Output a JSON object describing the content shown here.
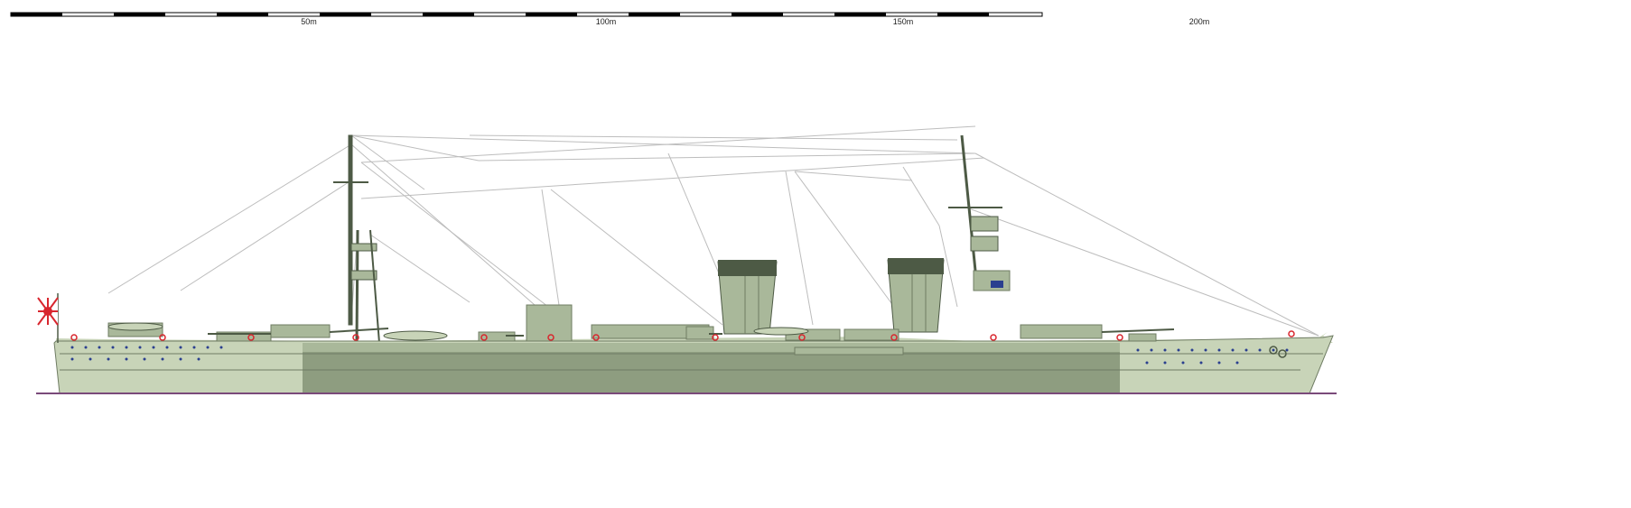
{
  "scale": {
    "unit_marks": [
      {
        "label": "50m"
      },
      {
        "label": "100m"
      },
      {
        "label": "150m"
      },
      {
        "label": "200m"
      }
    ]
  },
  "colors": {
    "hull_light": "#c8d4b8",
    "hull_mid": "#a9b89a",
    "hull_dark": "#8e9d80",
    "deck_line": "#6f7c63",
    "funnel_top": "#4d5a45",
    "rigging": "#bdbdbd",
    "waterline": "#7a4a7a",
    "flag_red": "#d8262e",
    "porthole": "#2a3f8f"
  },
  "icons": [
    "ensign-flag-icon",
    "bow-anchor-icon"
  ]
}
